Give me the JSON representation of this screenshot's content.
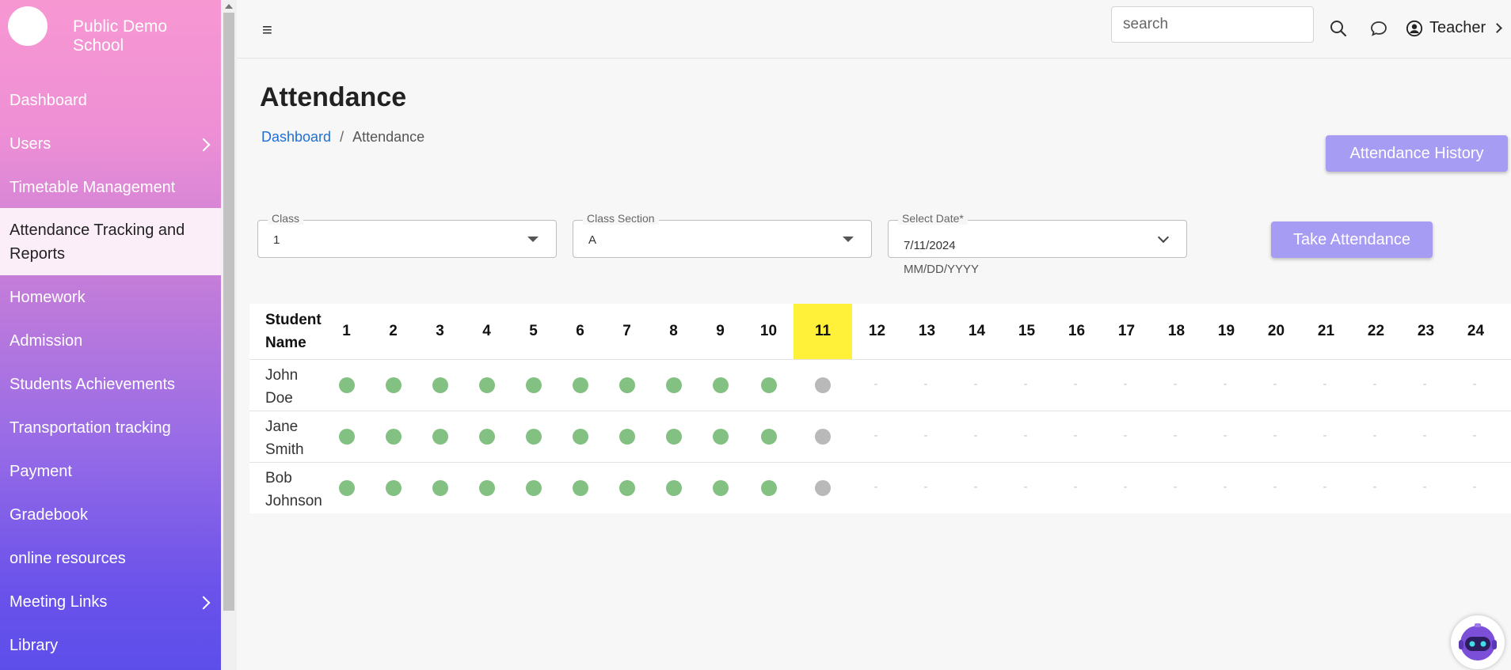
{
  "app": {
    "school_name": "Public Demo School"
  },
  "sidebar": {
    "items": [
      {
        "label": "Dashboard"
      },
      {
        "label": "Users"
      },
      {
        "label": "Timetable Management"
      },
      {
        "label": "Attendance Tracking and Reports"
      },
      {
        "label": "Homework"
      },
      {
        "label": "Admission"
      },
      {
        "label": "Students Achievements"
      },
      {
        "label": "Transportation tracking"
      },
      {
        "label": "Payment"
      },
      {
        "label": "Gradebook"
      },
      {
        "label": "online resources"
      },
      {
        "label": "Meeting Links"
      },
      {
        "label": "Library"
      }
    ]
  },
  "topbar": {
    "menu_icon": "hamburger-icon",
    "search_placeholder": "search",
    "search_icon": "search-icon",
    "chat_icon": "chat-icon",
    "user_icon": "user-circle-icon",
    "user_label": "Teacher"
  },
  "page": {
    "title": "Attendance",
    "breadcrumb": {
      "home": "Dashboard",
      "sep": "/",
      "current": "Attendance"
    },
    "history_button": "Attendance History",
    "take_button": "Take Attendance"
  },
  "filters": {
    "class": {
      "label": "Class",
      "value": "1"
    },
    "section": {
      "label": "Class Section",
      "value": "A"
    },
    "date": {
      "label": "Select Date*",
      "value": "7/11/2024",
      "helper": "MM/DD/YYYY"
    }
  },
  "table": {
    "name_header": "Student Name",
    "days": [
      "1",
      "2",
      "3",
      "4",
      "5",
      "6",
      "7",
      "8",
      "9",
      "10",
      "11",
      "12",
      "13",
      "14",
      "15",
      "16",
      "17",
      "18",
      "19",
      "20",
      "21",
      "22",
      "23",
      "24"
    ],
    "today_index": 10,
    "students": [
      {
        "name": "John Doe",
        "status": [
          "P",
          "P",
          "P",
          "P",
          "P",
          "P",
          "P",
          "P",
          "P",
          "P",
          "N",
          "-",
          "-",
          "-",
          "-",
          "-",
          "-",
          "-",
          "-",
          "-",
          "-",
          "-",
          "-",
          "-"
        ]
      },
      {
        "name": "Jane Smith",
        "status": [
          "P",
          "P",
          "P",
          "P",
          "P",
          "P",
          "P",
          "P",
          "P",
          "P",
          "N",
          "-",
          "-",
          "-",
          "-",
          "-",
          "-",
          "-",
          "-",
          "-",
          "-",
          "-",
          "-",
          "-"
        ]
      },
      {
        "name": "Bob Johnson",
        "status": [
          "P",
          "P",
          "P",
          "P",
          "P",
          "P",
          "P",
          "P",
          "P",
          "P",
          "N",
          "-",
          "-",
          "-",
          "-",
          "-",
          "-",
          "-",
          "-",
          "-",
          "-",
          "-",
          "-",
          "-"
        ]
      }
    ]
  },
  "colors": {
    "present": "#82c181",
    "not_marked": "#b9b9b9",
    "today_highlight": "#fff03a",
    "button": "#a79cf4",
    "link": "#1f6fd6"
  },
  "assistant_icon": "robot-assistant-icon"
}
